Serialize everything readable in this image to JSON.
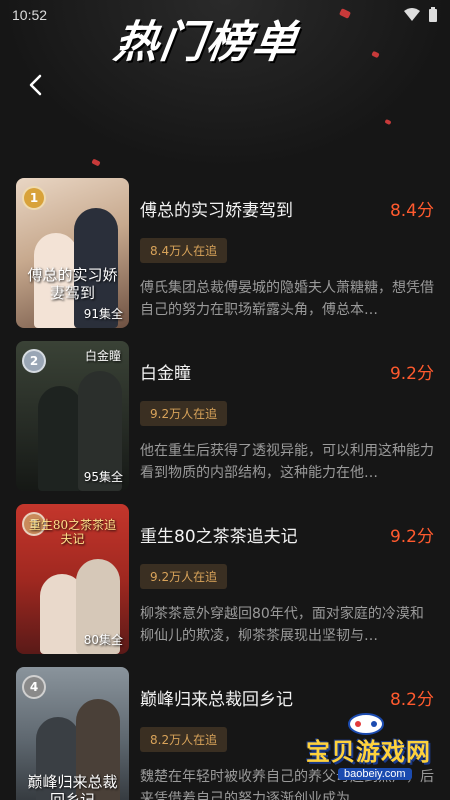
{
  "status_bar": {
    "time": "10:52"
  },
  "header": {
    "title": "热门榜单"
  },
  "dramas": [
    {
      "rank": "1",
      "cover_title": "傅总的实习娇妻驾到",
      "episodes": "91集全",
      "title": "傅总的实习娇妻驾到",
      "score": "8.4分",
      "followers": "8.4万人在追",
      "description": "傅氏集团总裁傅晏城的隐婚夫人萧糖糖，想凭借自己的努力在职场崭露头角，傅总本…",
      "rank_color": "#d8a23a"
    },
    {
      "rank": "2",
      "cover_title": "白金瞳",
      "episodes": "95集全",
      "title": "白金瞳",
      "score": "9.2分",
      "followers": "9.2万人在追",
      "description": "他在重生后获得了透视异能，可以利用这种能力看到物质的内部结构，这种能力在他…",
      "rank_color": "#9aa6b5"
    },
    {
      "rank": "3",
      "cover_title": "重生80之茶茶追夫记",
      "episodes": "80集全",
      "title": "重生80之茶茶追夫记",
      "score": "9.2分",
      "followers": "9.2万人在追",
      "description": "柳茶茶意外穿越回80年代，面对家庭的冷漠和柳仙儿的欺凌，柳茶茶展现出坚韧与…",
      "rank_color": "#c98a5a"
    },
    {
      "rank": "4",
      "cover_title": "巅峰归来总裁回乡记",
      "episodes": "",
      "title": "巅峰归来总裁回乡记",
      "score": "8.2分",
      "followers": "8.2万人在追",
      "description": "魏楚在年轻时被收养自己的养父母赶到黑厂，后来凭借着自己的努力逐渐创业成为…",
      "rank_color": "#8a8a8a"
    }
  ],
  "watermark": {
    "text": "宝贝游戏网",
    "url": "baobeiy.com"
  },
  "colors": {
    "accent": "#ff5a2e",
    "badge_bg": "#3a2f22",
    "badge_text": "#d8a35a"
  }
}
